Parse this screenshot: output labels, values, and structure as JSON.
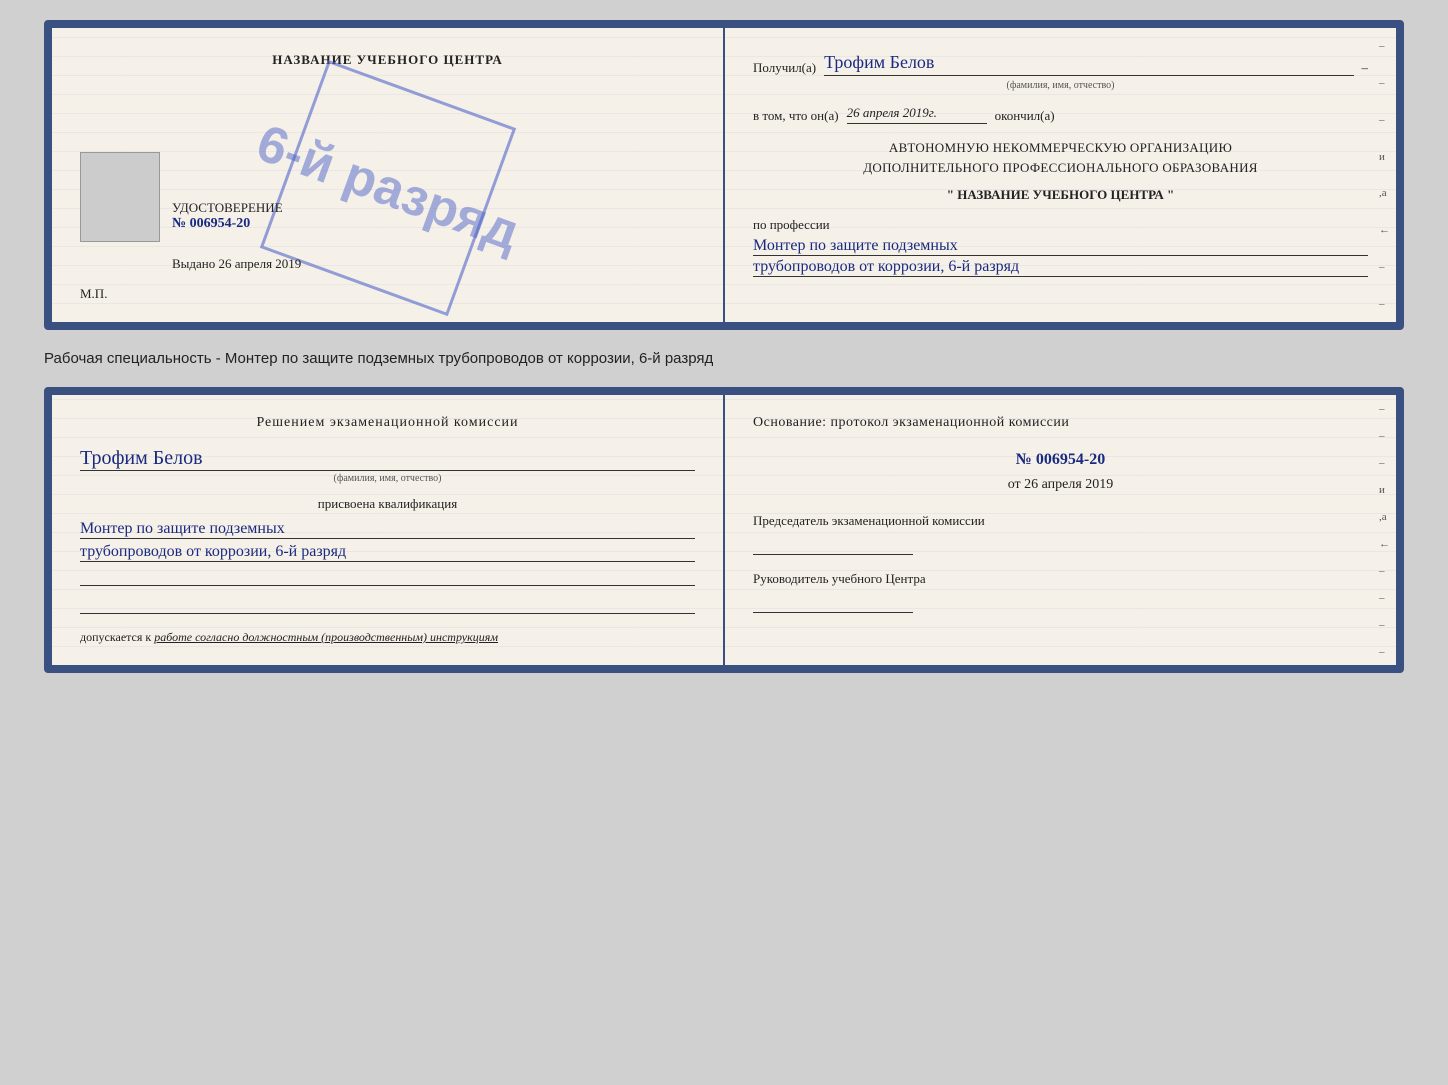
{
  "cert": {
    "left": {
      "title": "НАЗВАНИЕ УЧЕБНОГО ЦЕНТРА",
      "stamp_text": "6-й разряд",
      "udost_title": "УДОСТОВЕРЕНИЕ",
      "udost_number": "№ 006954-20",
      "vydano_label": "Выдано",
      "vydano_date": "26 апреля 2019",
      "mp_label": "М.П."
    },
    "right": {
      "poluchil_label": "Получил(а)",
      "poluchil_name": "Трофим Белов",
      "fio_subtitle": "(фамилия, имя, отчество)",
      "dash": "–",
      "vtomchto_label": "в том, что он(а)",
      "vtomchto_date": "26 апреля 2019г.",
      "okonchil": "окончил(а)",
      "org_line1": "АВТОНОМНУЮ НЕКОММЕРЧЕСКУЮ ОРГАНИЗАЦИЮ",
      "org_line2": "ДОПОЛНИТЕЛЬНОГО ПРОФЕССИОНАЛЬНОГО ОБРАЗОВАНИЯ",
      "org_name": "\" НАЗВАНИЕ УЧЕБНОГО ЦЕНТРА \"",
      "po_professii_label": "по профессии",
      "profession_line1": "Монтер по защите подземных",
      "profession_line2": "трубопроводов от коррозии, 6-й разряд",
      "margin_marks": [
        "–",
        "–",
        "–",
        "и",
        ",а",
        "←",
        "–",
        "–",
        "–",
        "–"
      ]
    }
  },
  "specialty_text": "Рабочая специальность - Монтер по защите подземных трубопроводов от коррозии, 6-й разряд",
  "bottom": {
    "left": {
      "section_title": "Решением экзаменационной комиссии",
      "name": "Трофим Белов",
      "fio_subtitle": "(фамилия, имя, отчество)",
      "prisvoena_label": "присвоена квалификация",
      "qual_line1": "Монтер по защите подземных",
      "qual_line2": "трубопроводов от коррозии, 6-й разряд",
      "dopusk_label": "допускается к",
      "dopusk_italic": "работе согласно должностным (производственным) инструкциям"
    },
    "right": {
      "osnov_title": "Основание: протокол экзаменационной комиссии",
      "number": "№  006954-20",
      "ot_label": "от",
      "ot_date": "26 апреля 2019",
      "predsed_label": "Председатель экзаменационной комиссии",
      "rukov_label": "Руководитель учебного Центра",
      "margin_marks": [
        "–",
        "–",
        "–",
        "и",
        ",а",
        "←",
        "–",
        "–",
        "–",
        "–"
      ]
    }
  }
}
